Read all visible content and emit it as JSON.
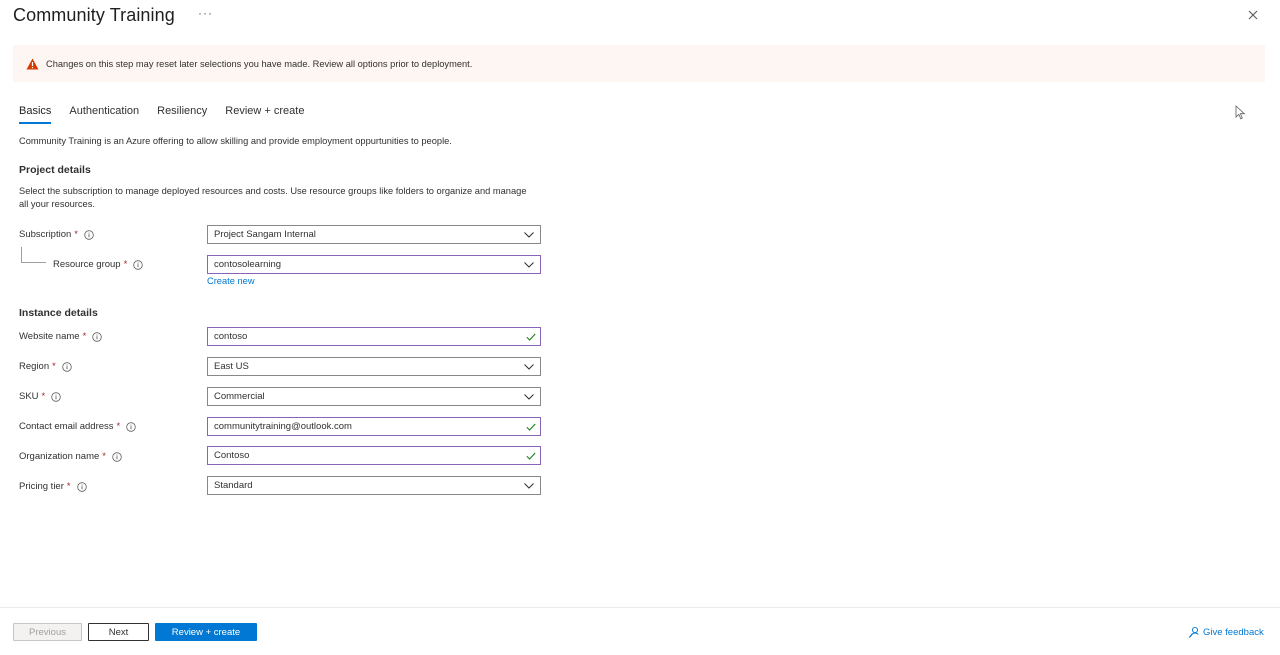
{
  "header": {
    "title": "Community Training",
    "more_label": "···"
  },
  "banner": {
    "text": "Changes on this step may reset later selections you have made. Review all options prior to deployment."
  },
  "tabs": [
    {
      "label": "Basics",
      "active": true
    },
    {
      "label": "Authentication",
      "active": false
    },
    {
      "label": "Resiliency",
      "active": false
    },
    {
      "label": "Review + create",
      "active": false
    }
  ],
  "intro": "Community Training is an Azure offering to allow skilling and provide employment oppurtunities to people.",
  "project": {
    "heading": "Project details",
    "description": "Select the subscription to manage deployed resources and costs. Use resource groups like folders to organize and manage all your resources.",
    "subscription": {
      "label": "Subscription",
      "required": "*",
      "value": "Project Sangam Internal"
    },
    "resource_group": {
      "label": "Resource group",
      "required": "*",
      "value": "contosolearning",
      "create_new": "Create new"
    }
  },
  "instance": {
    "heading": "Instance details",
    "website_name": {
      "label": "Website name",
      "required": "*",
      "value": "contoso"
    },
    "region": {
      "label": "Region",
      "required": "*",
      "value": "East US"
    },
    "sku": {
      "label": "SKU",
      "required": "*",
      "value": "Commercial"
    },
    "contact_email": {
      "label": "Contact email address",
      "required": "*",
      "value": "communitytraining@outlook.com"
    },
    "org_name": {
      "label": "Organization name",
      "required": "*",
      "value": "Contoso"
    },
    "pricing_tier": {
      "label": "Pricing tier",
      "required": "*",
      "value": "Standard"
    }
  },
  "footer": {
    "previous": "Previous",
    "next": "Next",
    "review": "Review + create",
    "feedback": "Give feedback"
  },
  "colors": {
    "accent": "#0078d4",
    "valid_border": "#8764b8",
    "valid_check": "#107c10",
    "warning": "#d83b01",
    "required": "#a4262c"
  }
}
